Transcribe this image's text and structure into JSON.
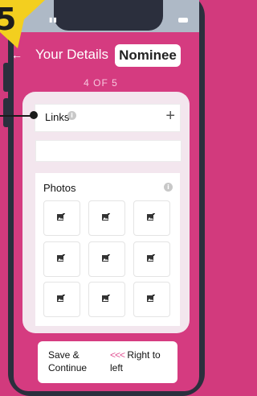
{
  "step_badge": "5",
  "header": {
    "back_icon": "arrow-left-icon",
    "title": "Your Details",
    "nominee_label": "Nominee",
    "step": "4 OF 5"
  },
  "links": {
    "label": "Links",
    "info_icon": "i",
    "add_icon": "+",
    "input_value": ""
  },
  "photos": {
    "title": "Photos",
    "info_icon": "i",
    "slots": [
      "add-photo-icon",
      "add-photo-icon",
      "add-photo-icon",
      "add-photo-icon",
      "add-photo-icon",
      "add-photo-icon",
      "add-photo-icon",
      "add-photo-icon",
      "add-photo-icon"
    ]
  },
  "bottom": {
    "save_line1": "Save &",
    "save_line2": "Continue",
    "rtl_arrows": "<<<",
    "rtl_line1": "Right to",
    "rtl_line2": "left"
  },
  "colors": {
    "background": "#d23a7d",
    "badge": "#f3cf1f",
    "card": "#f3e6ee"
  }
}
